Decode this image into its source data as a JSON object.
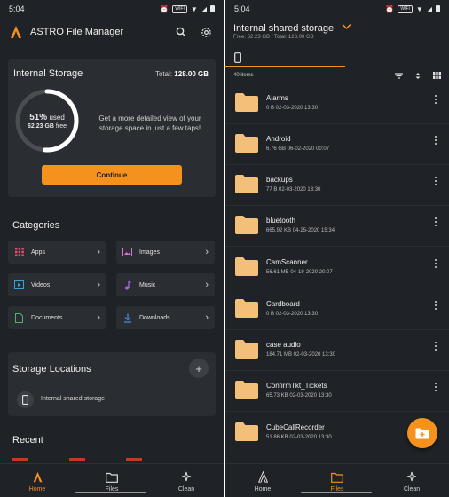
{
  "colors": {
    "accent": "#f5921e",
    "background": "#1f2226",
    "card": "#2a2d31",
    "folder": "#f3c07a"
  },
  "left": {
    "status": {
      "time": "5:04",
      "wifi_badge": "WIFI"
    },
    "header": {
      "title": "ASTRO File Manager",
      "search_icon": "search-icon",
      "settings_icon": "gear-icon"
    },
    "storage": {
      "title": "Internal Storage",
      "total_label": "Total:",
      "total_value": "128.00 GB",
      "used_percent": "51%",
      "used_fraction": 0.51,
      "used_label": "used",
      "free_value": "62.23 GB",
      "free_label": "free",
      "promo": "Get a more detailed view of your storage space in just a few taps!",
      "continue_label": "Continue"
    },
    "categories_title": "Categories",
    "categories": [
      {
        "label": "Apps",
        "icon": "apps-grid-icon",
        "color": "#e24b6a"
      },
      {
        "label": "Images",
        "icon": "image-icon",
        "color": "#d678d6"
      },
      {
        "label": "Videos",
        "icon": "video-icon",
        "color": "#3aa0d8"
      },
      {
        "label": "Music",
        "icon": "music-note-icon",
        "color": "#9b6ae0"
      },
      {
        "label": "Documents",
        "icon": "document-icon",
        "color": "#4cb56a"
      },
      {
        "label": "Downloads",
        "icon": "download-icon",
        "color": "#4a8ad8"
      }
    ],
    "locations": {
      "title": "Storage Locations",
      "add_label": "+",
      "item_label": "Internal shared storage"
    },
    "recent_title": "Recent"
  },
  "right": {
    "status": {
      "time": "5:04",
      "wifi_badge": "WIFI"
    },
    "header": {
      "title": "Internal shared storage",
      "subtitle": "Free: 62.23 GB / Total: 128.00 GB"
    },
    "item_count": "40 items",
    "files": [
      {
        "name": "Alarms",
        "meta": "0 B 02-03-2020 13:30"
      },
      {
        "name": "Android",
        "meta": "6.76 GB 06-02-2020 00:07"
      },
      {
        "name": "backups",
        "meta": "77 B 02-03-2020 13:30"
      },
      {
        "name": "bluetooth",
        "meta": "665.92 KB 04-25-2020 15:34"
      },
      {
        "name": "CamScanner",
        "meta": "56.61 MB 04-19-2020 20:07"
      },
      {
        "name": "Cardboard",
        "meta": "0 B 02-03-2020 13:30"
      },
      {
        "name": "case audio",
        "meta": "184.71 MB 02-03-2020 13:30"
      },
      {
        "name": "ConfirmTkt_Tickets",
        "meta": "65.73 KB 02-03-2020 13:30"
      },
      {
        "name": "CubeCallRecorder",
        "meta": "51.86 KB 02-03-2020 13:30"
      }
    ]
  },
  "nav": [
    {
      "label": "Home",
      "icon": "astro-home-icon"
    },
    {
      "label": "Files",
      "icon": "folder-icon"
    },
    {
      "label": "Clean",
      "icon": "sparkle-icon"
    }
  ]
}
